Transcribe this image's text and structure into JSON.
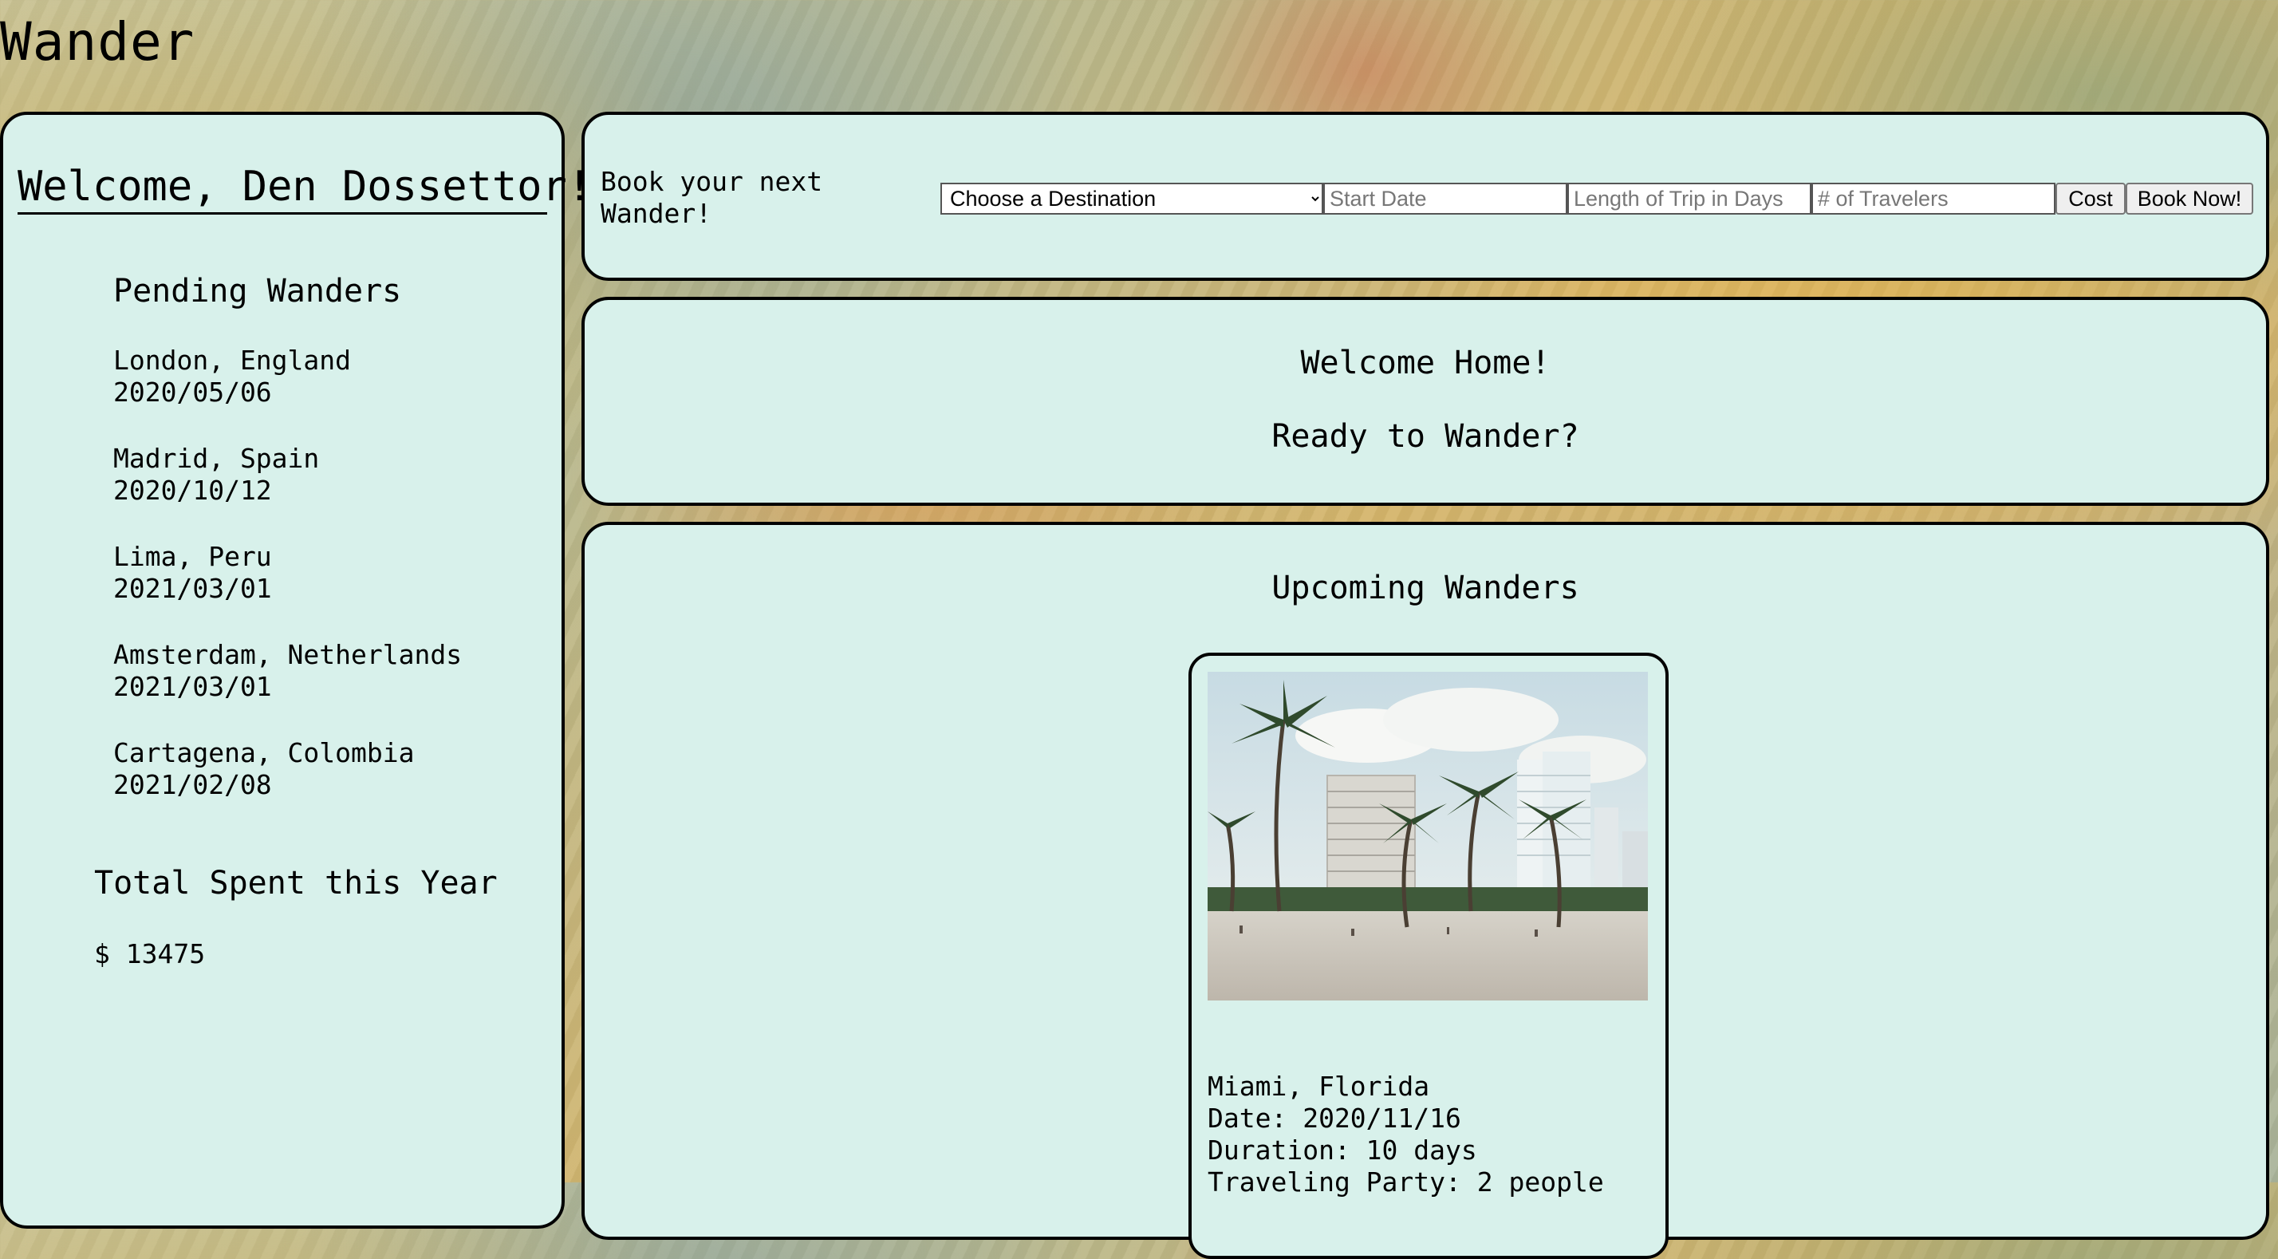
{
  "app": {
    "title": "Wander"
  },
  "sidebar": {
    "welcome": "Welcome, Den Dossettor!",
    "pending_title": "Pending Wanders",
    "pending": [
      {
        "destination": "London, England",
        "date": "2020/05/06"
      },
      {
        "destination": "Madrid, Spain",
        "date": "2020/10/12"
      },
      {
        "destination": "Lima, Peru",
        "date": "2021/03/01"
      },
      {
        "destination": "Amsterdam, Netherlands",
        "date": "2021/03/01"
      },
      {
        "destination": "Cartagena, Colombia",
        "date": "2021/02/08"
      }
    ],
    "total_title": "Total Spent this Year",
    "total_amount": "$ 13475"
  },
  "booking": {
    "prompt": "Book your next Wander!",
    "destination_selected": "Choose a Destination",
    "start_date_placeholder": "Start Date",
    "length_placeholder": "Length of Trip in Days",
    "travelers_placeholder": "# of Travelers",
    "cost_label": "Cost",
    "book_label": "Book Now!"
  },
  "welcome_panel": {
    "line1": "Welcome Home!",
    "line2": "Ready to Wander?"
  },
  "upcoming": {
    "title": "Upcoming Wanders",
    "trips": [
      {
        "image": "palm-beach-photo",
        "destination": "Miami, Florida",
        "date": "Date: 2020/11/16",
        "duration": "Duration: 10 days",
        "party": "Traveling Party: 2 people"
      }
    ]
  },
  "colors": {
    "panel_bg": "#d8f1eb",
    "border": "#000000"
  }
}
